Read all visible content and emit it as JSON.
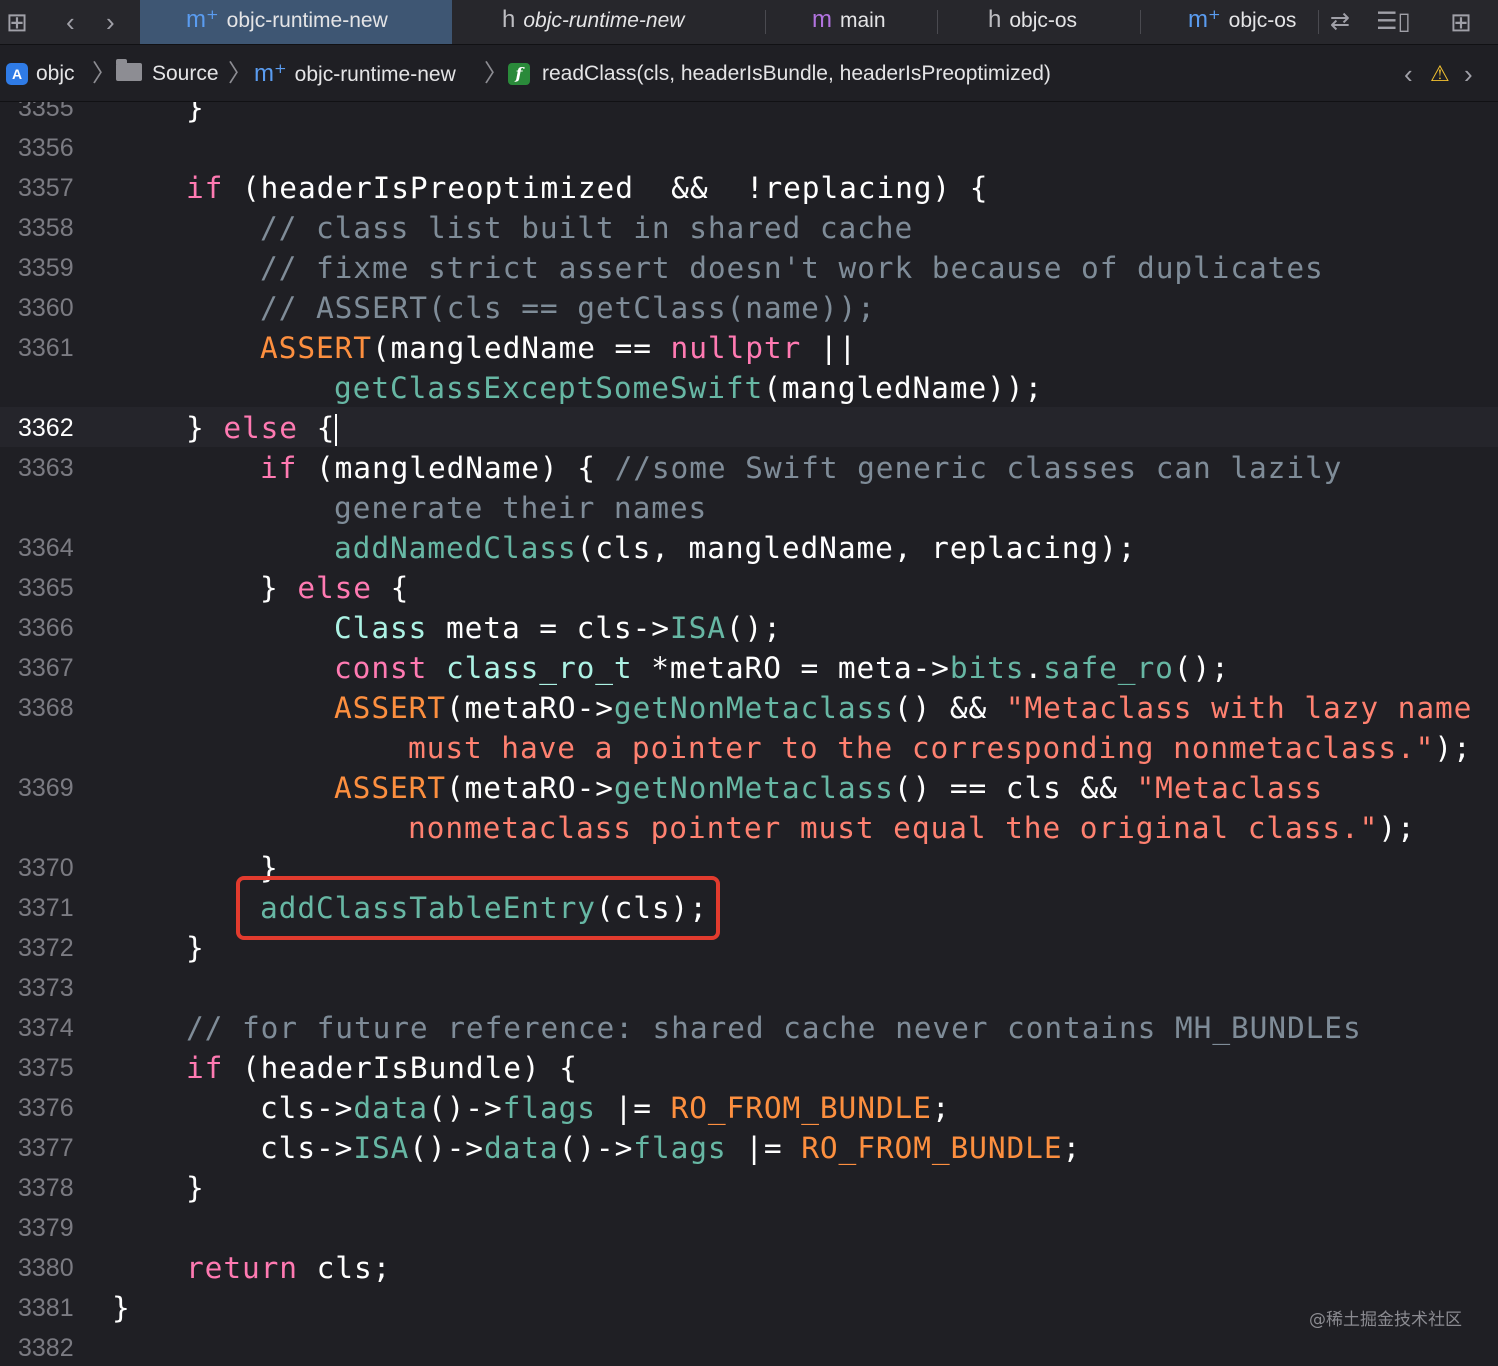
{
  "tabbar": {
    "tabs": [
      {
        "icon": "m⁺",
        "name": "objc-runtime-new",
        "active": true,
        "italic": false
      },
      {
        "icon": "h",
        "name": "objc-runtime-new",
        "active": false,
        "italic": true
      },
      {
        "icon": "m",
        "name": "main",
        "active": false,
        "italic": false
      },
      {
        "icon": "h",
        "name": "objc-os",
        "active": false,
        "italic": false
      },
      {
        "icon": "m⁺",
        "name": "objc-os",
        "active": false,
        "italic": false
      }
    ]
  },
  "jumpbar": {
    "project": "objc",
    "folder": "Source",
    "file": "objc-runtime-new",
    "function": "readClass(cls, headerIsBundle, headerIsPreoptimized)"
  },
  "editor": {
    "current_line": "3362",
    "lines": [
      {
        "n": "3355"
      },
      {
        "n": "3356"
      },
      {
        "n": "3357"
      },
      {
        "n": "3358"
      },
      {
        "n": "3359"
      },
      {
        "n": "3360"
      },
      {
        "n": "3361"
      },
      {
        "n": "3362"
      },
      {
        "n": "3363"
      },
      {
        "n": "3364"
      },
      {
        "n": "3365"
      },
      {
        "n": "3366"
      },
      {
        "n": "3367"
      },
      {
        "n": "3368"
      },
      {
        "n": "3369"
      },
      {
        "n": "3370"
      },
      {
        "n": "3371"
      },
      {
        "n": "3372"
      },
      {
        "n": "3373"
      },
      {
        "n": "3374"
      },
      {
        "n": "3375"
      },
      {
        "n": "3376"
      },
      {
        "n": "3377"
      },
      {
        "n": "3378"
      },
      {
        "n": "3379"
      },
      {
        "n": "3380"
      },
      {
        "n": "3381"
      },
      {
        "n": "3382"
      }
    ]
  },
  "watermark": "@稀土掘金技术社区",
  "colors": {
    "background": "#1f1f24",
    "keyword": "#ff7ab2",
    "function": "#67b7a4",
    "macro": "#fd8f3f",
    "comment": "#7f8c98",
    "string": "#ff8170",
    "highlight_border": "#e23b2e",
    "active_tab": "#3e5673"
  }
}
